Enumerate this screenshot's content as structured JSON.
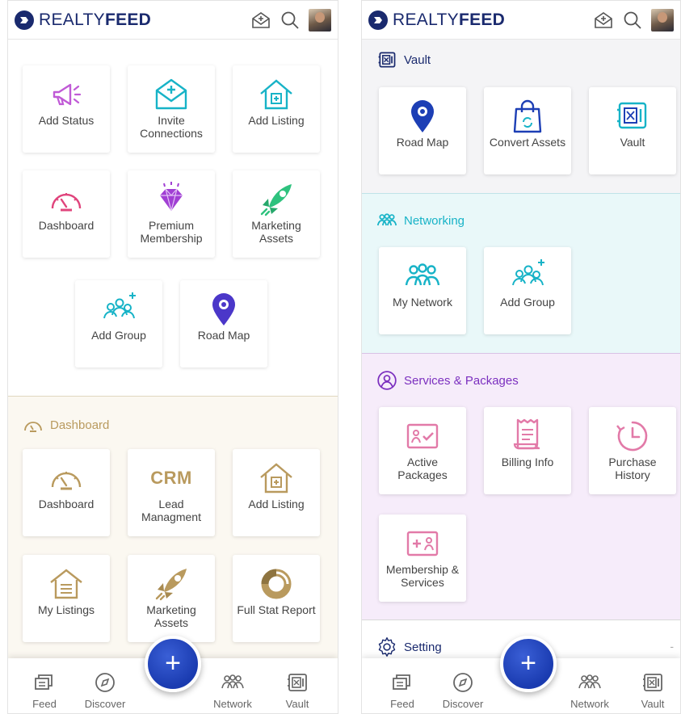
{
  "brand": {
    "prefix": "REALTY",
    "suffix": "FEED"
  },
  "left": {
    "top_tiles": [
      {
        "label": "Add Status"
      },
      {
        "label": "Invite Connections"
      },
      {
        "label": "Add Listing"
      },
      {
        "label": "Dashboard"
      },
      {
        "label": "Premium Membership"
      },
      {
        "label": "Marketing Assets"
      },
      {
        "label": "Add Group"
      },
      {
        "label": "Road Map"
      }
    ],
    "dashboard_section": {
      "title": "Dashboard",
      "tiles": [
        {
          "label": "Dashboard"
        },
        {
          "label": "Lead Managment",
          "badge": "CRM"
        },
        {
          "label": "Add Listing"
        },
        {
          "label": "My Listings"
        },
        {
          "label": "Marketing Assets"
        },
        {
          "label": "Full Stat Report"
        }
      ]
    }
  },
  "right": {
    "vault_section": {
      "title": "Vault",
      "tiles": [
        {
          "label": "Road Map"
        },
        {
          "label": "Convert Assets"
        },
        {
          "label": "Vault"
        }
      ]
    },
    "networking_section": {
      "title": "Networking",
      "tiles": [
        {
          "label": "My Network"
        },
        {
          "label": "Add Group"
        }
      ]
    },
    "services_section": {
      "title": "Services & Packages",
      "tiles": [
        {
          "label": "Active Packages"
        },
        {
          "label": "Billing Info"
        },
        {
          "label": "Purchase History"
        },
        {
          "label": "Membership & Services"
        }
      ]
    },
    "setting_section": {
      "title": "Setting",
      "trailing": "-"
    }
  },
  "bottom_nav": {
    "items": [
      {
        "label": "Feed",
        "icon": "feed-icon"
      },
      {
        "label": "Discover",
        "icon": "compass-icon"
      },
      {
        "label": "Network",
        "icon": "network-icon"
      },
      {
        "label": "Vault",
        "icon": "vault-icon"
      }
    ],
    "fab": "+"
  },
  "colors": {
    "brand_navy": "#1a2a6e",
    "gold": "#b99a5e",
    "teal": "#17b3c7",
    "purple": "#7b2fbf",
    "pink": "#e0447c",
    "fab_blue": "#1e40b8",
    "dashboard_bg": "#fbf8f1",
    "networking_bg": "#e9f8f9",
    "services_bg": "#f6ecfa",
    "vault_bg": "#f4f4f6"
  }
}
